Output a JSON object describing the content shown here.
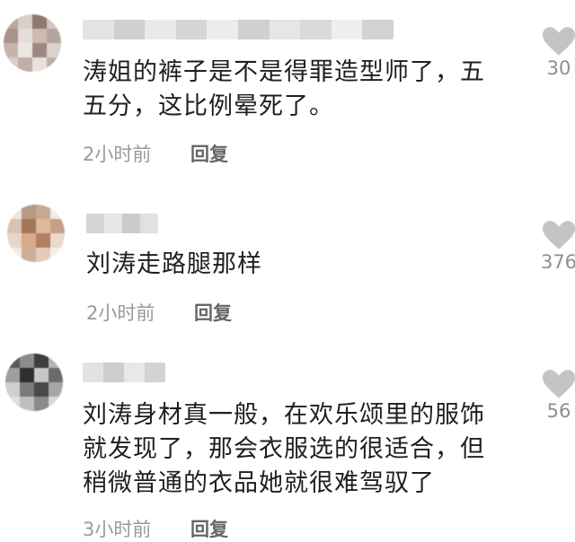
{
  "icons": {
    "like": "heart-icon"
  },
  "colors": {
    "heart": "#c4c4c4",
    "meta": "#9a9a9a"
  },
  "comments": [
    {
      "text": "涛姐的裤子是不是得罪造型师了，五\n五分，这比例晕死了。",
      "time": "2小时前",
      "reply": "回复",
      "likes": "30"
    },
    {
      "text": "刘涛走路腿那样",
      "time": "2小时前",
      "reply": "回复",
      "likes": "376"
    },
    {
      "text": "刘涛身材真一般，在欢乐颂里的服饰\n就发现了，那会衣服选的很适合，但\n稍微普通的衣品她就很难驾驭了",
      "time": "3小时前",
      "reply": "回复",
      "likes": "56"
    }
  ]
}
